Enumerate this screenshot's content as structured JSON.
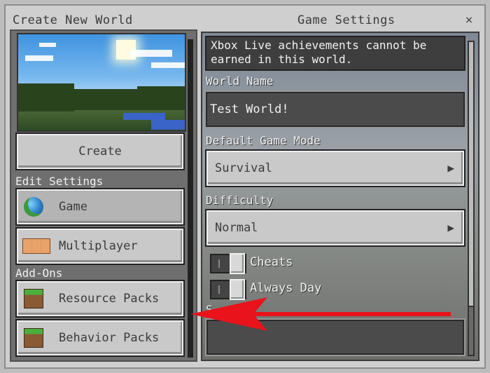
{
  "window": {
    "left_title": "Create New World",
    "right_title": "Game Settings",
    "close_glyph": "×"
  },
  "left": {
    "create_label": "Create",
    "edit_settings_label": "Edit Settings",
    "edit_items": [
      {
        "label": "Game",
        "icon": "globe-icon"
      },
      {
        "label": "Multiplayer",
        "icon": "players-icon"
      }
    ],
    "addons_label": "Add-Ons",
    "addon_items": [
      {
        "label": "Resource Packs",
        "icon": "grass-block-icon"
      },
      {
        "label": "Behavior Packs",
        "icon": "grass-block-icon"
      }
    ]
  },
  "right": {
    "notice": "Xbox Live achievements cannot be earned in this world.",
    "world_name_label": "World Name",
    "world_name_value": "Test World!",
    "game_mode_label": "Default Game Mode",
    "game_mode_value": "Survival",
    "difficulty_label": "Difficulty",
    "difficulty_value": "Normal",
    "toggles": [
      {
        "label": "Cheats",
        "on": false
      },
      {
        "label": "Always Day",
        "on": false
      }
    ],
    "seed_label": "S"
  },
  "colors": {
    "annotation_arrow": "#e8131b",
    "button_face": "#c9c9c9",
    "text_light": "#f2f2f2"
  }
}
